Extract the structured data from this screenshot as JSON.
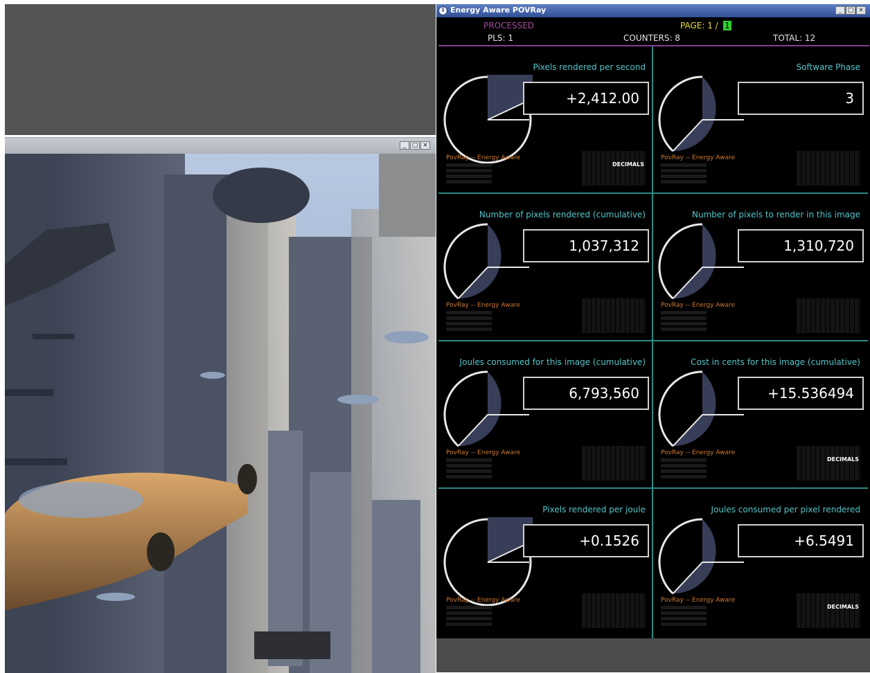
{
  "render_window": {
    "buttons": [
      "_",
      "□",
      "×"
    ]
  },
  "app": {
    "title": "Energy Aware POVRay",
    "title_icon": "info-icon",
    "buttons": [
      "_",
      "□",
      "×"
    ],
    "header": {
      "processed": "PROCESSED",
      "page_label": "PAGE: 1 /",
      "page_current": "1",
      "pls": "PLS: 1",
      "counters": "COUNTERS: 8",
      "total": "TOTAL: 12"
    },
    "panels": [
      {
        "title": "Pixels rendered per second",
        "value": "+2,412.00",
        "source": "PovRay -- Energy Aware",
        "decimals": "DECIMALS",
        "gauge_fraction": 0.18
      },
      {
        "title": "Software Phase",
        "value": "3",
        "source": "PovRay -- Energy Aware",
        "decimals": "",
        "gauge_fraction": 0.62
      },
      {
        "title": "Number of pixels rendered (cumulative)",
        "value": "1,037,312",
        "source": "PovRay -- Energy Aware",
        "decimals": "",
        "gauge_fraction": 0.62
      },
      {
        "title": "Number of pixels to render in this image",
        "value": "1,310,720",
        "source": "PovRay -- Energy Aware",
        "decimals": "",
        "gauge_fraction": 0.62
      },
      {
        "title": "Joules consumed for this image (cumulative)",
        "value": "6,793,560",
        "source": "PovRay -- Energy Aware",
        "decimals": "",
        "gauge_fraction": 0.62
      },
      {
        "title": "Cost in cents for this image (cumulative)",
        "value": "+15.536494",
        "source": "PovRay -- Energy Aware",
        "decimals": "DECIMALS",
        "gauge_fraction": 0.62
      },
      {
        "title": "Pixels rendered per joule",
        "value": "+0.1526",
        "source": "PovRay -- Energy Aware",
        "decimals": "",
        "gauge_fraction": 0.18
      },
      {
        "title": "Joules consumed per pixel rendered",
        "value": "+6.5491",
        "source": "PovRay -- Energy Aware",
        "decimals": "DECIMALS",
        "gauge_fraction": 0.62
      }
    ]
  },
  "colors": {
    "gauge_fill": "#383e58",
    "gauge_stroke": "#e8e8e8",
    "title_cyan": "#53c5c9",
    "processed_purple": "#a14ca0",
    "page_yellow": "#e9de3a",
    "page_green": "#33cc33",
    "source_orange": "#cf7a30"
  }
}
